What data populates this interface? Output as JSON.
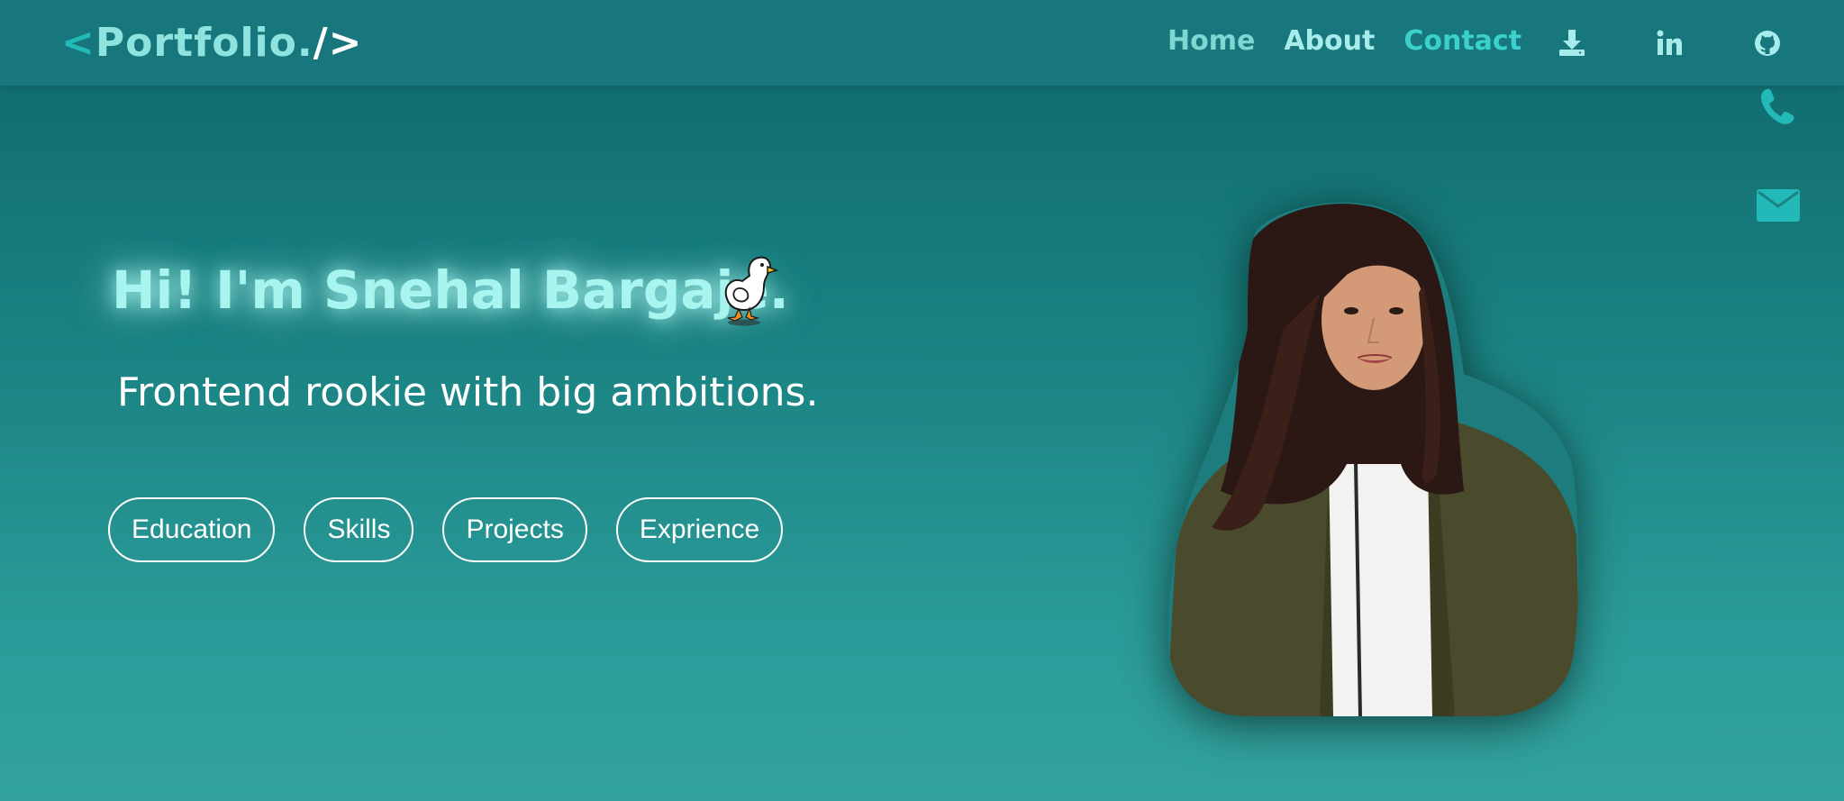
{
  "brand": {
    "lt": "<",
    "name": "Portfolio.",
    "gt": "/>"
  },
  "nav": {
    "home": "Home",
    "about": "About",
    "contact": "Contact"
  },
  "nav_icons": [
    "download-icon",
    "linkedin-icon",
    "github-icon"
  ],
  "side_icons": [
    "phone-icon",
    "email-icon"
  ],
  "hero": {
    "title": "Hi! I'm Snehal Bargaje.",
    "subtitle": "Frontend rookie with big ambitions.",
    "chips": [
      "Education",
      "Skills",
      "Projects",
      "Exprience"
    ]
  },
  "colors": {
    "navbar": "#17777c",
    "accent": "#23b9b9",
    "title_glow": "#a7f5ee",
    "background_top": "#0f676a",
    "background_bottom": "#33a29d"
  }
}
